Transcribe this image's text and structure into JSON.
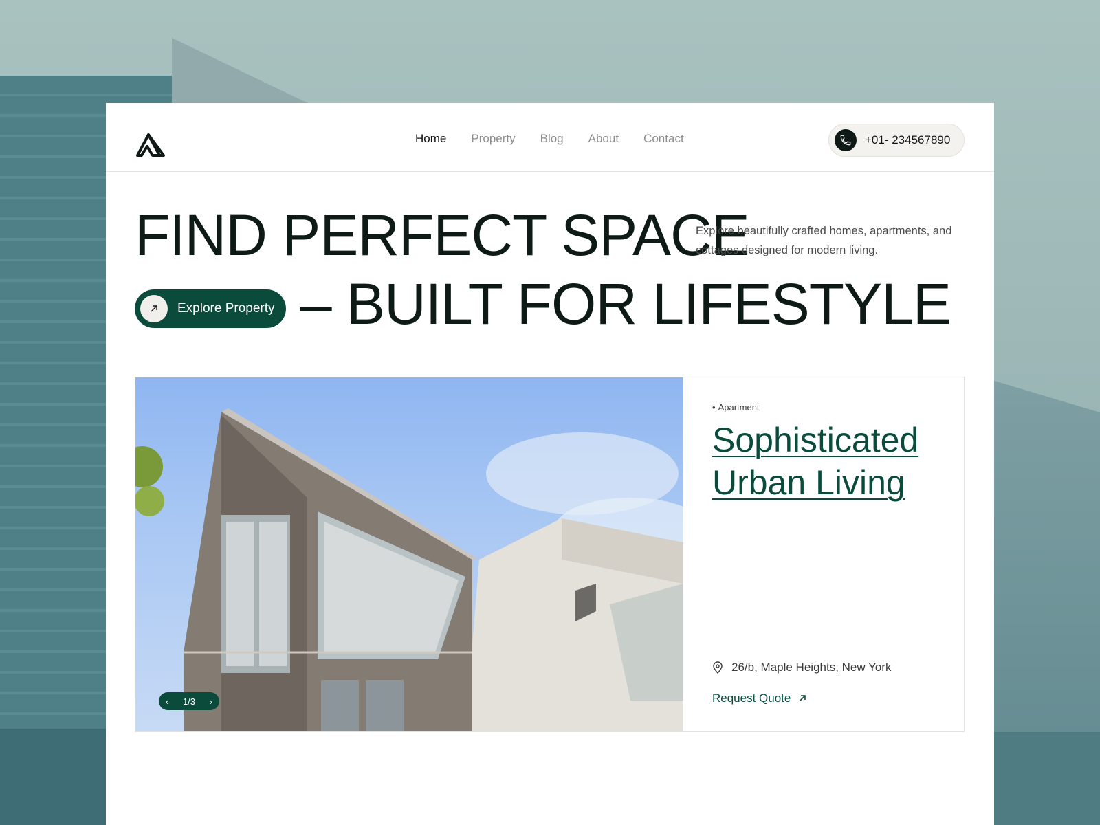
{
  "nav": {
    "items": [
      {
        "label": "Home",
        "active": true
      },
      {
        "label": "Property",
        "active": false
      },
      {
        "label": "Blog",
        "active": false
      },
      {
        "label": "About",
        "active": false
      },
      {
        "label": "Contact",
        "active": false
      }
    ],
    "phone": "+01- 234567890",
    "logo_icon": "house-logo-icon",
    "phone_icon": "phone-icon"
  },
  "hero": {
    "line1": "FIND PERFECT SPACE",
    "line2": "– BUILT FOR LIFESTYLE",
    "description": "Explore beautifully crafted homes, apartments, and cottages designed for modern living.",
    "cta_label": "Explore Property",
    "cta_icon": "arrow-up-right-icon"
  },
  "listing": {
    "tag": "Apartment",
    "title": "Sophisticated Urban Living",
    "address": "26/b, Maple Heights, New York",
    "quote_label": "Request Quote",
    "pager": "1/3"
  },
  "colors": {
    "accent": "#0b4b3c",
    "text_dark": "#0e1a16",
    "muted": "#8d8d8d",
    "background": "#a9c2c0"
  }
}
